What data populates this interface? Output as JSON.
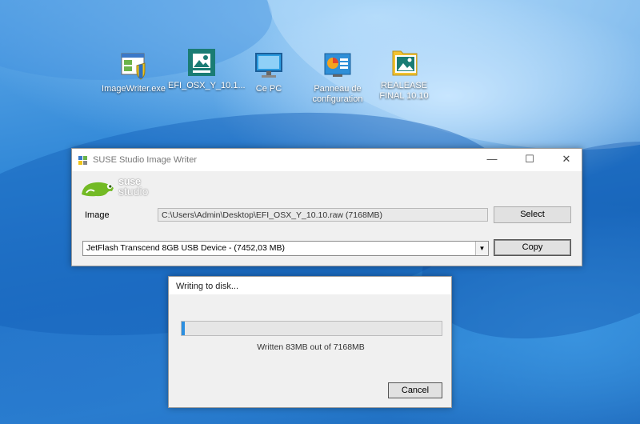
{
  "desktop": {
    "icons": [
      {
        "label": "ImageWriter.exe",
        "icon": "app-shield-icon"
      },
      {
        "label": "EFI_OSX_Y_10.1...",
        "icon": "image-file-icon"
      },
      {
        "label": "Ce PC",
        "icon": "computer-monitor-icon"
      },
      {
        "label": "Panneau de configuration",
        "icon": "control-panel-icon"
      },
      {
        "label": "REALEASE FINAL 10.10",
        "icon": "image-folder-icon"
      }
    ]
  },
  "window": {
    "title": "SUSE Studio Image Writer",
    "controls": {
      "minimize": "—",
      "maximize": "☐",
      "close": "✕"
    },
    "logo_top": "suse",
    "logo_bottom": "studio",
    "image_label": "Image",
    "image_path": "C:\\Users\\Admin\\Desktop\\EFI_OSX_Y_10.10.raw (7168MB)",
    "select_button": "Select",
    "device": "JetFlash Transcend 8GB USB Device - (7452,03 MB)",
    "copy_button": "Copy"
  },
  "progress_dialog": {
    "title": "Writing to disk...",
    "progress": 0.0116,
    "status": "Written 83MB out of 7168MB",
    "cancel_button": "Cancel"
  },
  "colors": {
    "progress_fill": "#2c8fe0",
    "suse_green": "#73ba25"
  }
}
